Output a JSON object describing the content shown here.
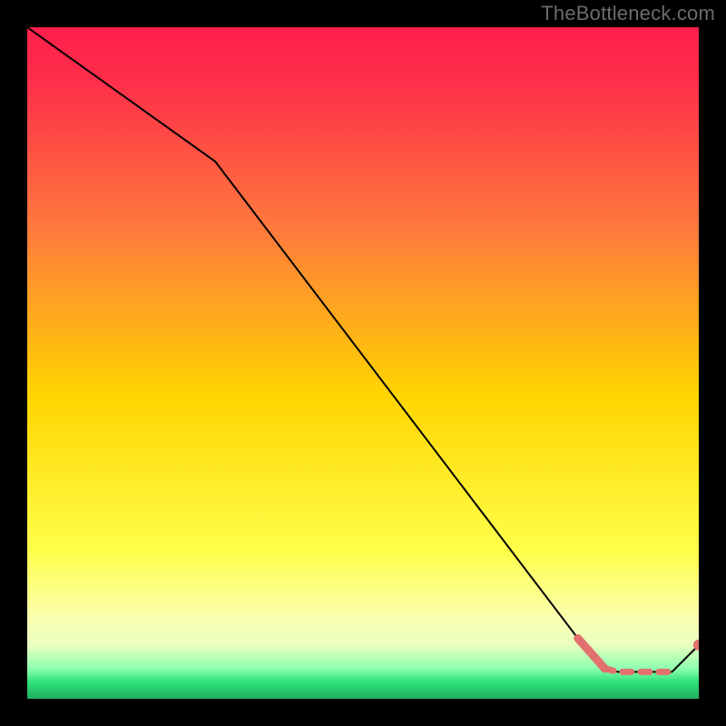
{
  "watermark": "TheBottleneck.com",
  "colors": {
    "frame": "#000000",
    "grad_top": "#ff1f4b",
    "grad_mid1": "#ff7a3d",
    "grad_mid2": "#ffd500",
    "grad_mid3": "#ffff4a",
    "grad_band": "#f6ffb0",
    "grad_green": "#2fe07a",
    "line": "#000000",
    "marker": "#e2706e"
  },
  "chart_data": {
    "type": "line",
    "title": "",
    "xlabel": "",
    "ylabel": "",
    "xlim": [
      0,
      100
    ],
    "ylim": [
      0,
      100
    ],
    "series": [
      {
        "name": "main-line",
        "x": [
          0,
          28,
          82,
          86,
          88,
          90,
          92,
          94,
          96,
          100
        ],
        "y": [
          100,
          80,
          9,
          4.5,
          4,
          4,
          4,
          4,
          4,
          8
        ]
      },
      {
        "name": "emphasis-segment",
        "x": [
          82,
          86
        ],
        "y": [
          9,
          4.5
        ]
      },
      {
        "name": "dashed-plateau",
        "x": [
          86,
          88,
          90,
          92,
          94,
          96
        ],
        "y": [
          4.5,
          4,
          4,
          4,
          4,
          4
        ]
      },
      {
        "name": "end-marker",
        "x": [
          100
        ],
        "y": [
          8
        ]
      }
    ]
  }
}
